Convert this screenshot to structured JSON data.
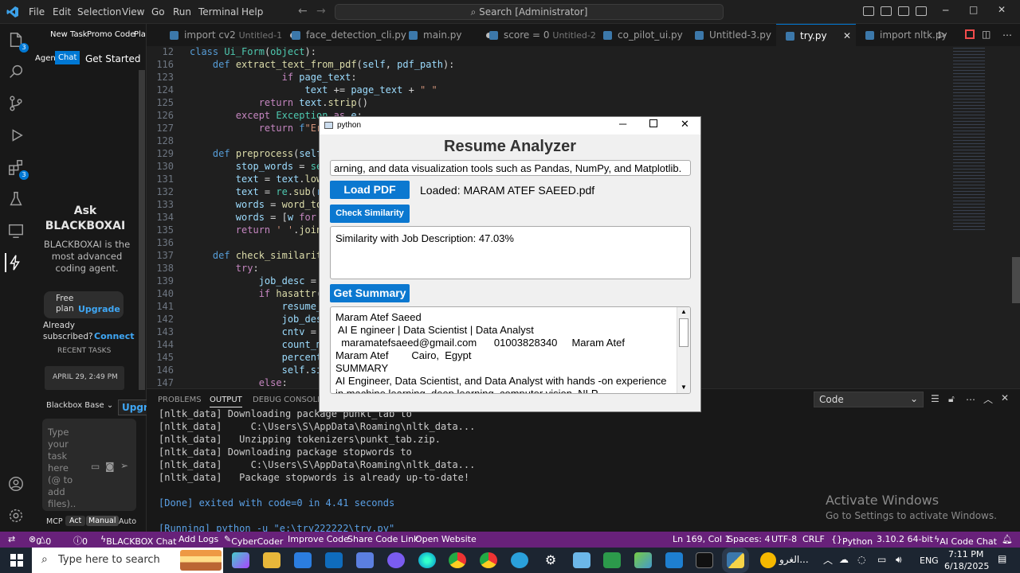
{
  "menu": [
    "File",
    "Edit",
    "Selection",
    "View",
    "Go",
    "Run",
    "Terminal",
    "Help"
  ],
  "search": {
    "text": "Search [Administrator]"
  },
  "activity_badges": {
    "explorer": "3",
    "extensions": "3"
  },
  "sidebar": {
    "top_items": [
      "New Task",
      "Promo Code",
      "Pla"
    ],
    "tab_agent": "Agent",
    "tab_chat": "Chat",
    "get_started": "Get Started",
    "ask_title": "Ask\nBLACKBOXAI",
    "ask_desc": "BLACKBOXAI is the most advanced coding agent.",
    "free_plan": "Free plan",
    "upgrade": "Upgrade",
    "already": "Already subscribed?",
    "connect": "Connect",
    "recent_tasks": "RECENT TASKS",
    "recent_date": "APRIL 29, 2:49 PM",
    "model_select": "Blackbox Base",
    "upgrade_btn": "Upgra",
    "input_placeholder": "Type your task here (@ to add files)..",
    "modes": [
      "MCP",
      "Act",
      "Manual",
      "Auto"
    ]
  },
  "tabs": [
    {
      "label": "import cv2",
      "sub": "Untitled-1",
      "dirty": true
    },
    {
      "label": "face_detection_cli.py",
      "sub": "",
      "dirty": false
    },
    {
      "label": "main.py",
      "sub": "",
      "dirty": true
    },
    {
      "label": "score = 0",
      "sub": "Untitled-2",
      "dirty": true
    },
    {
      "label": "co_pilot_ui.py",
      "sub": "",
      "dirty": false
    },
    {
      "label": "Untitled-3.py",
      "sub": "",
      "dirty": false
    },
    {
      "label": "try.py",
      "sub": "",
      "dirty": false,
      "active": true,
      "close": "✕"
    },
    {
      "label": "import nltk.py",
      "sub": "",
      "dirty": false
    }
  ],
  "code": [
    {
      "n": "12",
      "t": "class Ui_Form(object):"
    },
    {
      "n": "116",
      "t": "    def extract_text_from_pdf(self, pdf_path):"
    },
    {
      "n": "123",
      "t": "                if page_text:"
    },
    {
      "n": "124",
      "t": "                    text += page_text + \" \""
    },
    {
      "n": "125",
      "t": "            return text.strip()"
    },
    {
      "n": "126",
      "t": "        except Exception as e:"
    },
    {
      "n": "127",
      "t": "            return f\"Erro"
    },
    {
      "n": "128",
      "t": ""
    },
    {
      "n": "129",
      "t": "    def preprocess(self,"
    },
    {
      "n": "130",
      "t": "        stop_words = set("
    },
    {
      "n": "131",
      "t": "        text = text.lower"
    },
    {
      "n": "132",
      "t": "        text = re.sub(r'["
    },
    {
      "n": "133",
      "t": "        words = word_toke"
    },
    {
      "n": "134",
      "t": "        words = [w for w"
    },
    {
      "n": "135",
      "t": "        return ' '.join(w"
    },
    {
      "n": "136",
      "t": ""
    },
    {
      "n": "137",
      "t": "    def check_similarity("
    },
    {
      "n": "138",
      "t": "        try:"
    },
    {
      "n": "139",
      "t": "            job_desc = se"
    },
    {
      "n": "140",
      "t": "            if hasattr(se"
    },
    {
      "n": "141",
      "t": "                resume_cl"
    },
    {
      "n": "142",
      "t": "                job_desc_"
    },
    {
      "n": "143",
      "t": "                cntv = Co"
    },
    {
      "n": "144",
      "t": "                count_mat"
    },
    {
      "n": "145",
      "t": "                percentag"
    },
    {
      "n": "146",
      "t": "                self.simi"
    },
    {
      "n": "147",
      "t": "            else:"
    }
  ],
  "panel": {
    "tabs": [
      "PROBLEMS",
      "OUTPUT",
      "DEBUG CONSOLE"
    ],
    "channel": "Code",
    "lines": [
      "[nltk_data] Downloading package punkt_tab to",
      "[nltk_data]     C:\\Users\\S\\AppData\\Roaming\\nltk_data...",
      "[nltk_data]   Unzipping tokenizers\\punkt_tab.zip.",
      "[nltk_data] Downloading package stopwords to",
      "[nltk_data]     C:\\Users\\S\\AppData\\Roaming\\nltk_data...",
      "[nltk_data]   Package stopwords is already up-to-date!",
      "",
      "[Done] exited with code=0 in 4.41 seconds",
      "",
      "[Running] python -u \"e:\\try222222\\try.py\""
    ]
  },
  "activate": {
    "title": "Activate Windows",
    "sub": "Go to Settings to activate Windows."
  },
  "status": {
    "errors": "0",
    "warnings": "0",
    "info": "0",
    "left_items": [
      "BLACKBOX Chat",
      "Add Logs",
      "CyberCoder",
      "Improve Code",
      "Share Code Link",
      "Open Website"
    ],
    "position": "Ln 169, Col 1",
    "spaces": "Spaces: 4",
    "encoding": "UTF-8",
    "eol": "CRLF",
    "language": "Python",
    "interpreter": "3.10.2 64-bit",
    "ai": "AI Code Chat"
  },
  "taskbar": {
    "search": "Type here to search",
    "weather": "الغرو...",
    "lang": "ENG",
    "time": "7:11 PM",
    "date": "6/18/2025"
  },
  "dialog": {
    "title": "python",
    "heading": "Resume Analyzer",
    "job_desc_value": "arning, and data visualization tools such as Pandas, NumPy, and Matplotlib.",
    "load_pdf": "Load PDF",
    "loaded_label": "Loaded: MARAM ATEF SAEED.pdf",
    "check_similarity": "Check Similarity",
    "similarity_result": "Similarity with Job Description: 47.03%",
    "get_summary": "Get Summary",
    "summary_lines": [
      "Maram Atef Saeed",
      " AI E ngineer | Data Scientist | Data Analyst",
      "  maramatefsaeed@gmail.com      01003828340     Maram Atef",
      "Maram Atef        Cairo,  Egypt",
      "SUMMARY",
      "AI Engineer, Data Scientist, and Data Analyst with hands -on experience",
      "in machine learning, deep learning, computer vision, NLP,"
    ]
  }
}
